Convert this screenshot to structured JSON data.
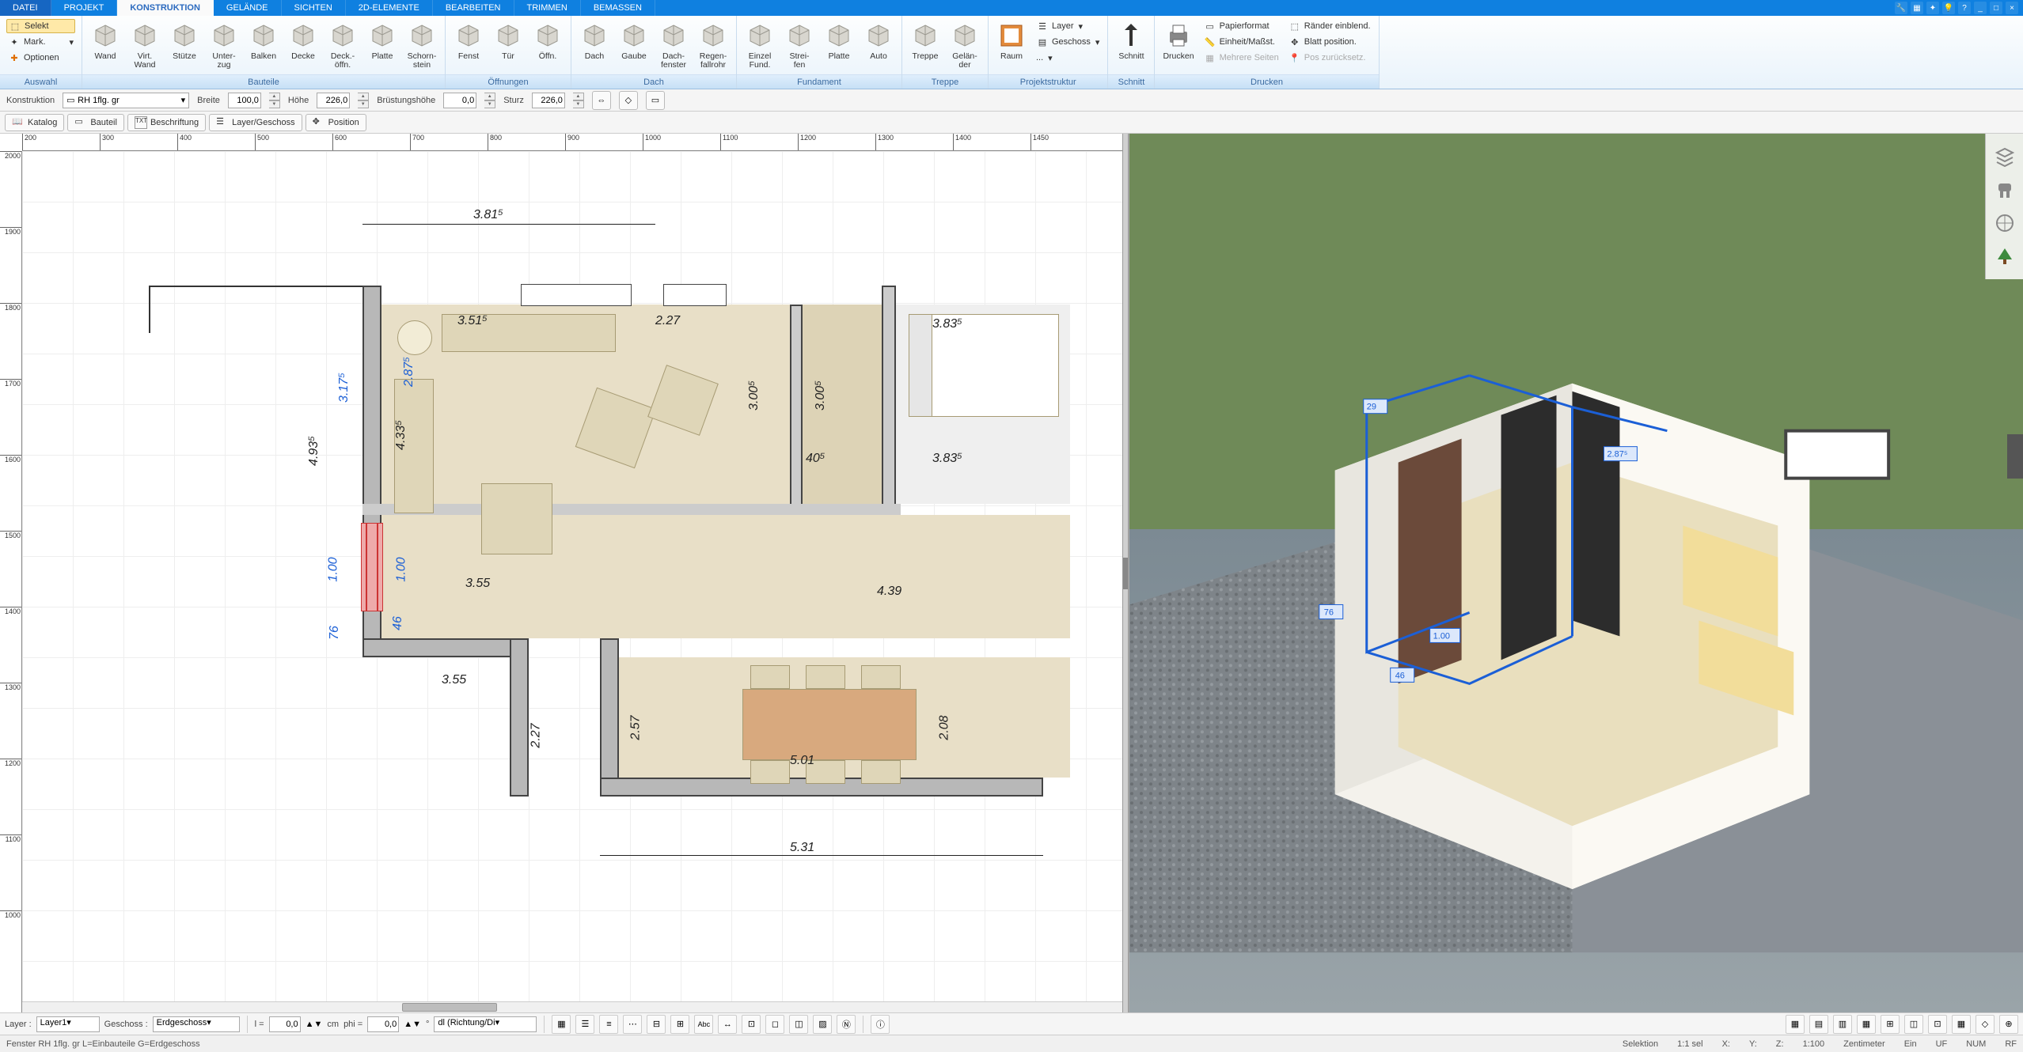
{
  "menu": {
    "tabs": [
      "DATEI",
      "PROJEKT",
      "KONSTRUKTION",
      "GELÄNDE",
      "SICHTEN",
      "2D-ELEMENTE",
      "BEARBEITEN",
      "TRIMMEN",
      "BEMASSEN"
    ],
    "active": "KONSTRUKTION"
  },
  "sys_icons": [
    "wrench",
    "box",
    "plug",
    "tip",
    "help",
    "min",
    "max",
    "close"
  ],
  "ribbon": {
    "auswahl": {
      "cap": "Auswahl",
      "selekt": "Selekt",
      "mark": "Mark.",
      "optionen": "Optionen"
    },
    "bauteile": {
      "cap": "Bauteile",
      "items": [
        "Wand",
        "Virt.\nWand",
        "Stütze",
        "Unter-\nzug",
        "Balken",
        "Decke",
        "Deck.-\nöffn.",
        "Platte",
        "Schorn-\nstein"
      ]
    },
    "oeffnungen": {
      "cap": "Öffnungen",
      "items": [
        "Fenst",
        "Tür",
        "Öffn."
      ]
    },
    "dach": {
      "cap": "Dach",
      "items": [
        "Dach",
        "Gaube",
        "Dach-\nfenster",
        "Regen-\nfallrohr"
      ]
    },
    "fundament": {
      "cap": "Fundament",
      "items": [
        "Einzel\nFund.",
        "Strei-\nfen",
        "Platte",
        "Auto"
      ]
    },
    "treppe": {
      "cap": "Treppe",
      "items": [
        "Treppe",
        "Gelän-\nder"
      ]
    },
    "projekt": {
      "cap": "Projektstruktur",
      "raum": "Raum",
      "layer": "Layer",
      "geschoss": "Geschoss",
      "mehr": "..."
    },
    "schnitt": {
      "cap": "Schnitt",
      "label": "Schnitt"
    },
    "drucken": {
      "cap": "Drucken",
      "label": "Drucken",
      "opts": [
        "Papierformat",
        "Einheit/Maßst.",
        "Mehrere Seiten",
        "Ränder einblend.",
        "Blatt position.",
        "Pos zurücksetz."
      ]
    }
  },
  "param": {
    "kategorie": "Konstruktion",
    "element": "RH 1flg. gr",
    "breite_lbl": "Breite",
    "breite": "100,0",
    "hoehe_lbl": "Höhe",
    "hoehe": "226,0",
    "bruest_lbl": "Brüstungshöhe",
    "bruest": "0,0",
    "sturz_lbl": "Sturz",
    "sturz": "226,0"
  },
  "tbar2": {
    "katalog": "Katalog",
    "bauteil": "Bauteil",
    "beschriftung": "Beschriftung",
    "layergeschoss": "Layer/Geschoss",
    "position": "Position"
  },
  "ruler_h": [
    "200",
    "300",
    "400",
    "500",
    "600",
    "700",
    "800",
    "900",
    "1000",
    "1100",
    "1200",
    "1300",
    "1400",
    "1450"
  ],
  "ruler_v": [
    "2000",
    "1900",
    "1800",
    "1700",
    "1600",
    "1500",
    "1400",
    "1300",
    "1200",
    "1100",
    "1000"
  ],
  "dims": {
    "top": "3.81⁵",
    "room_top": "3.51⁵",
    "r2": "2.27",
    "r3": "3.83⁵",
    "left_out": "4.93⁵",
    "left_blue": "3.17⁵",
    "win_h": "1.00",
    "win_sill": "76",
    "inner_l": "4.33⁵",
    "inner_l2": "2.87⁵",
    "h1": "3.00⁵",
    "h2": "3.00⁵",
    "w40": "40⁵",
    "r4": "3.83⁵",
    "mid_l": "3.55",
    "mid_r": "4.39",
    "sill2": "46",
    "one": "1.00",
    "bot_l": "3.55",
    "bot_h1": "2.27",
    "bot_h2": "2.57",
    "bot_w": "5.01",
    "bot_h3": "2.08",
    "bottom": "5.31"
  },
  "view3d": {
    "labels": {
      "a": "29",
      "b": "2.87⁵",
      "c": "76",
      "d": "1.00",
      "e": "46"
    }
  },
  "bottom": {
    "layer_lbl": "Layer :",
    "layer": "Layer1",
    "geschoss_lbl": "Geschoss :",
    "geschoss": "Erdgeschoss",
    "l_lbl": "l =",
    "l": "0,0",
    "cm": "cm",
    "phi_lbl": "phi =",
    "phi": "0,0",
    "deg": "°",
    "dl": "dl (Richtung/Di"
  },
  "status": {
    "left": "Fenster RH 1flg. gr L=Einbauteile G=Erdgeschoss",
    "sel": "Selektion",
    "ratio": "1:1 sel",
    "x": "X:",
    "y": "Y:",
    "z": "Z:",
    "scale": "1:100",
    "unit": "Zentimeter",
    "ein": "Ein",
    "uf": "UF",
    "num": "NUM",
    "rf": "RF"
  }
}
